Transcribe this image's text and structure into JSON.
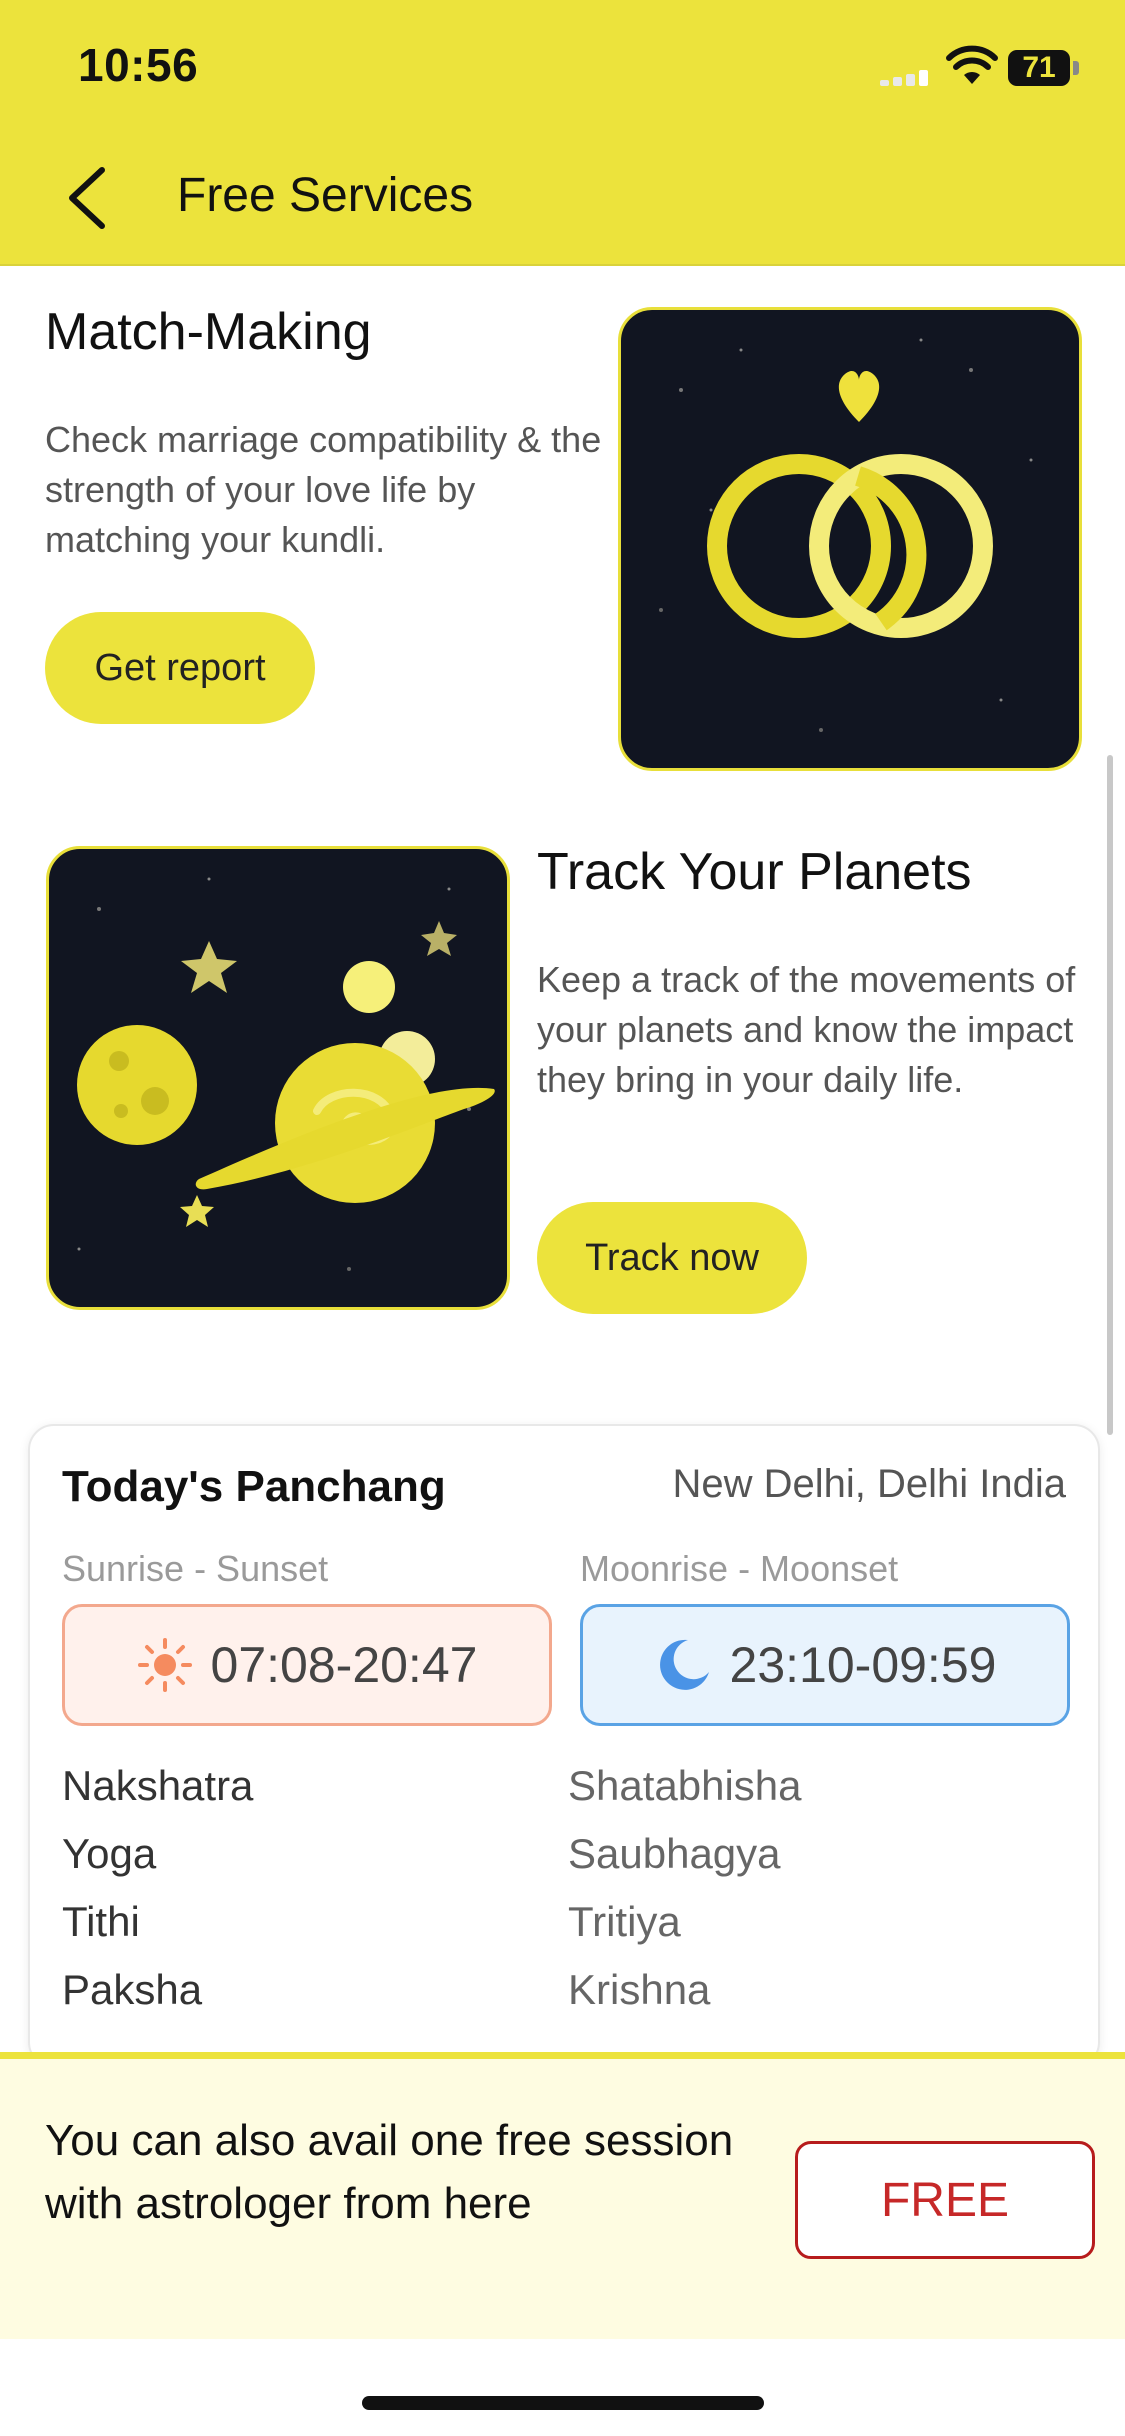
{
  "status_bar": {
    "time": "10:56",
    "battery": "71"
  },
  "header": {
    "title": "Free Services"
  },
  "match_making": {
    "title": "Match-Making",
    "description": "Check marriage compatibility & the strength of your love life by matching your kundli.",
    "button_label": "Get report"
  },
  "track_planets": {
    "title": "Track Your Planets",
    "description": "Keep a track of the movements of your planets and know the impact they bring in your daily life.",
    "button_label": "Track now"
  },
  "panchang": {
    "title": "Today's Panchang",
    "location": "New Delhi, Delhi India",
    "sun_label": "Sunrise - Sunset",
    "sun_time": "07:08-20:47",
    "moon_label": "Moonrise - Moonset",
    "moon_time": "23:10-09:59",
    "rows": [
      {
        "label": "Nakshatra",
        "value": "Shatabhisha"
      },
      {
        "label": "Yoga",
        "value": "Saubhagya"
      },
      {
        "label": "Tithi",
        "value": "Tritiya"
      },
      {
        "label": "Paksha",
        "value": "Krishna"
      }
    ]
  },
  "promo": {
    "text": "You can also avail one free session with astrologer from here",
    "button_label": "FREE"
  },
  "colors": {
    "accent": "#ece33c",
    "promo_bg": "#fefce1",
    "free_red": "#c62828"
  }
}
